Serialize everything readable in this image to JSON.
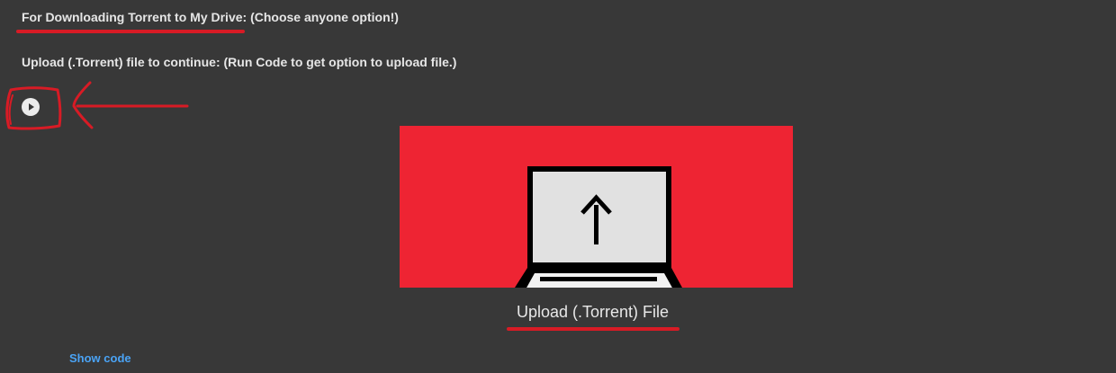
{
  "cell": {
    "heading": "For Downloading Torrent to My Drive: (Choose anyone option!)",
    "subheading": "Upload (.Torrent) file to continue: (Run Code to get option to upload file.)",
    "run_button_icon": "play-icon",
    "upload_icon": "laptop-upload-icon",
    "upload_label": "Upload (.Torrent) File",
    "show_code_label": "Show code"
  },
  "colors": {
    "background": "#383838",
    "banner": "#ee2433",
    "annotation": "#d81b25",
    "link": "#4aa3f5"
  }
}
